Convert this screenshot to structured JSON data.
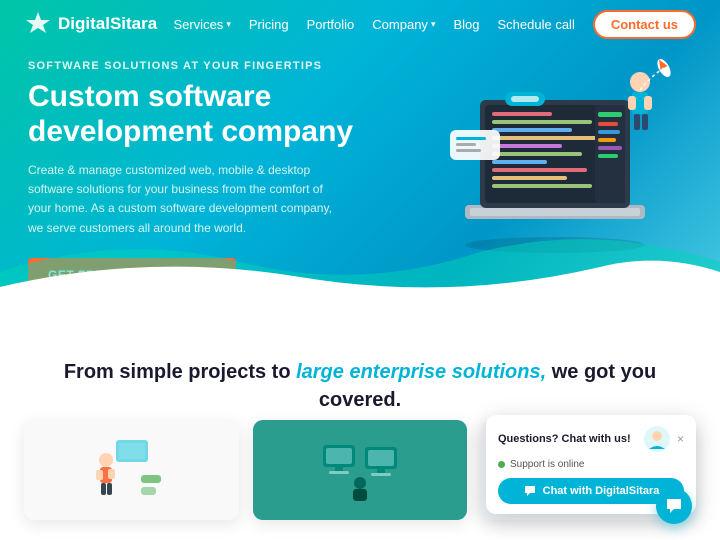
{
  "brand": {
    "name": "DigitalSitara",
    "logo_alt": "DigitalSitara logo star"
  },
  "nav": {
    "links": [
      {
        "label": "Services",
        "has_dropdown": true
      },
      {
        "label": "Pricing",
        "has_dropdown": false
      },
      {
        "label": "Portfolio",
        "has_dropdown": false
      },
      {
        "label": "Company",
        "has_dropdown": true
      },
      {
        "label": "Blog",
        "has_dropdown": false
      }
    ],
    "schedule_label": "Schedule call",
    "contact_label": "Contact us"
  },
  "hero": {
    "subtitle": "SOFTWARE SOLUTIONS AT YOUR FINGERTIPS",
    "title": "Custom software development company",
    "description": "Create & manage customized web, mobile & desktop software solutions for your business from the comfort of your home. As a custom software development company, we serve customers all around the world.",
    "cta_label": "GET FREE QUOTE NOW",
    "cta_arrow": "→"
  },
  "tagline": {
    "part1": "From simple projects to ",
    "highlight": "large enterprise solutions,",
    "part2": " we got you covered."
  },
  "chat_widget": {
    "title": "Questions? Chat with us!",
    "status": "Support is online",
    "button_label": "Chat with DigitalSitara",
    "close_icon": "×"
  },
  "fab": {
    "icon": "💬"
  },
  "colors": {
    "teal": "#00b4d8",
    "orange": "#ff6b2b",
    "dark": "#1a1a2e",
    "green": "#4caf50"
  }
}
